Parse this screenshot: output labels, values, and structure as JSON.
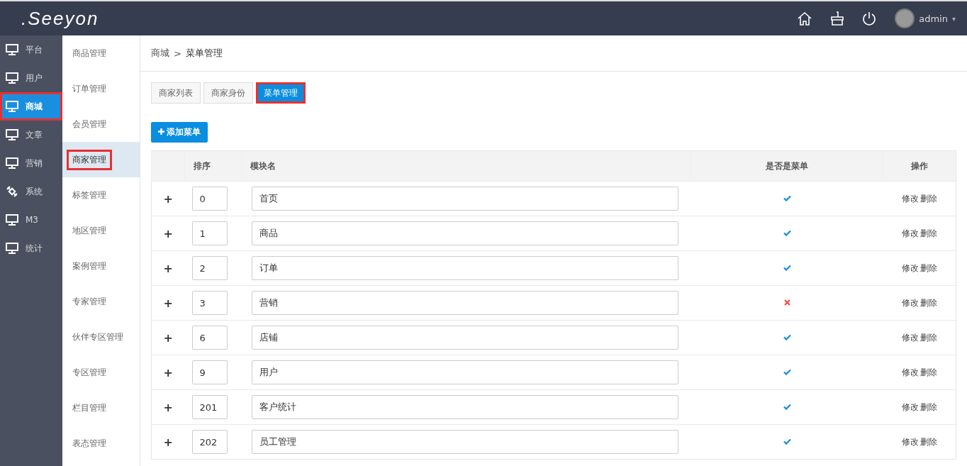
{
  "header": {
    "logo": ".Seeyon",
    "user": {
      "name": "admin",
      "caret": "▾"
    }
  },
  "nav": [
    {
      "label": "平台",
      "kind": "monitor",
      "selected": false,
      "highlighted": false
    },
    {
      "label": "用户",
      "kind": "monitor",
      "selected": false,
      "highlighted": false
    },
    {
      "label": "商城",
      "kind": "monitor",
      "selected": true,
      "highlighted": true
    },
    {
      "label": "文章",
      "kind": "monitor",
      "selected": false,
      "highlighted": false
    },
    {
      "label": "营销",
      "kind": "monitor",
      "selected": false,
      "highlighted": false
    },
    {
      "label": "系统",
      "kind": "satellite",
      "selected": false,
      "highlighted": false
    },
    {
      "label": "M3",
      "kind": "monitor",
      "selected": false,
      "highlighted": false
    },
    {
      "label": "统计",
      "kind": "monitor",
      "selected": false,
      "highlighted": false
    }
  ],
  "subnav": [
    {
      "label": "商品管理",
      "selected": false,
      "highlighted": false
    },
    {
      "label": "订单管理",
      "selected": false,
      "highlighted": false
    },
    {
      "label": "会员管理",
      "selected": false,
      "highlighted": false
    },
    {
      "label": "商家管理",
      "selected": true,
      "highlighted": true
    },
    {
      "label": "标签管理",
      "selected": false,
      "highlighted": false
    },
    {
      "label": "地区管理",
      "selected": false,
      "highlighted": false
    },
    {
      "label": "案例管理",
      "selected": false,
      "highlighted": false
    },
    {
      "label": "专家管理",
      "selected": false,
      "highlighted": false
    },
    {
      "label": "伙伴专区管理",
      "selected": false,
      "highlighted": false
    },
    {
      "label": "专区管理",
      "selected": false,
      "highlighted": false
    },
    {
      "label": "栏目管理",
      "selected": false,
      "highlighted": false
    },
    {
      "label": "表态管理",
      "selected": false,
      "highlighted": false
    }
  ],
  "breadcrumb": {
    "parent": "商城",
    "separator": ">",
    "current": "菜单管理"
  },
  "tabs": [
    {
      "label": "商家列表",
      "selected": false,
      "highlighted": false
    },
    {
      "label": "商家身份",
      "selected": false,
      "highlighted": false
    },
    {
      "label": "菜单管理",
      "selected": true,
      "highlighted": true
    }
  ],
  "add_button": {
    "label": "添加菜单"
  },
  "table": {
    "columns": [
      "排序",
      "模块名",
      "是否是菜单",
      "操作"
    ],
    "rows": [
      {
        "expand": "+",
        "order": "0",
        "name": "首页",
        "is_menu": true,
        "actions": [
          "修改",
          "删除"
        ]
      },
      {
        "expand": "+",
        "order": "1",
        "name": "商品",
        "is_menu": true,
        "actions": [
          "修改",
          "删除"
        ]
      },
      {
        "expand": "+",
        "order": "2",
        "name": "订单",
        "is_menu": true,
        "actions": [
          "修改",
          "删除"
        ]
      },
      {
        "expand": "+",
        "order": "3",
        "name": "营销",
        "is_menu": false,
        "actions": [
          "修改",
          "删除"
        ]
      },
      {
        "expand": "+",
        "order": "6",
        "name": "店铺",
        "is_menu": true,
        "actions": [
          "修改",
          "删除"
        ]
      },
      {
        "expand": "+",
        "order": "9",
        "name": "用户",
        "is_menu": true,
        "actions": [
          "修改",
          "删除"
        ]
      },
      {
        "expand": "+",
        "order": "201",
        "name": "客户统计",
        "is_menu": true,
        "actions": [
          "修改",
          "删除"
        ]
      },
      {
        "expand": "+",
        "order": "202",
        "name": "员工管理",
        "is_menu": true,
        "actions": [
          "修改",
          "删除"
        ]
      }
    ]
  }
}
